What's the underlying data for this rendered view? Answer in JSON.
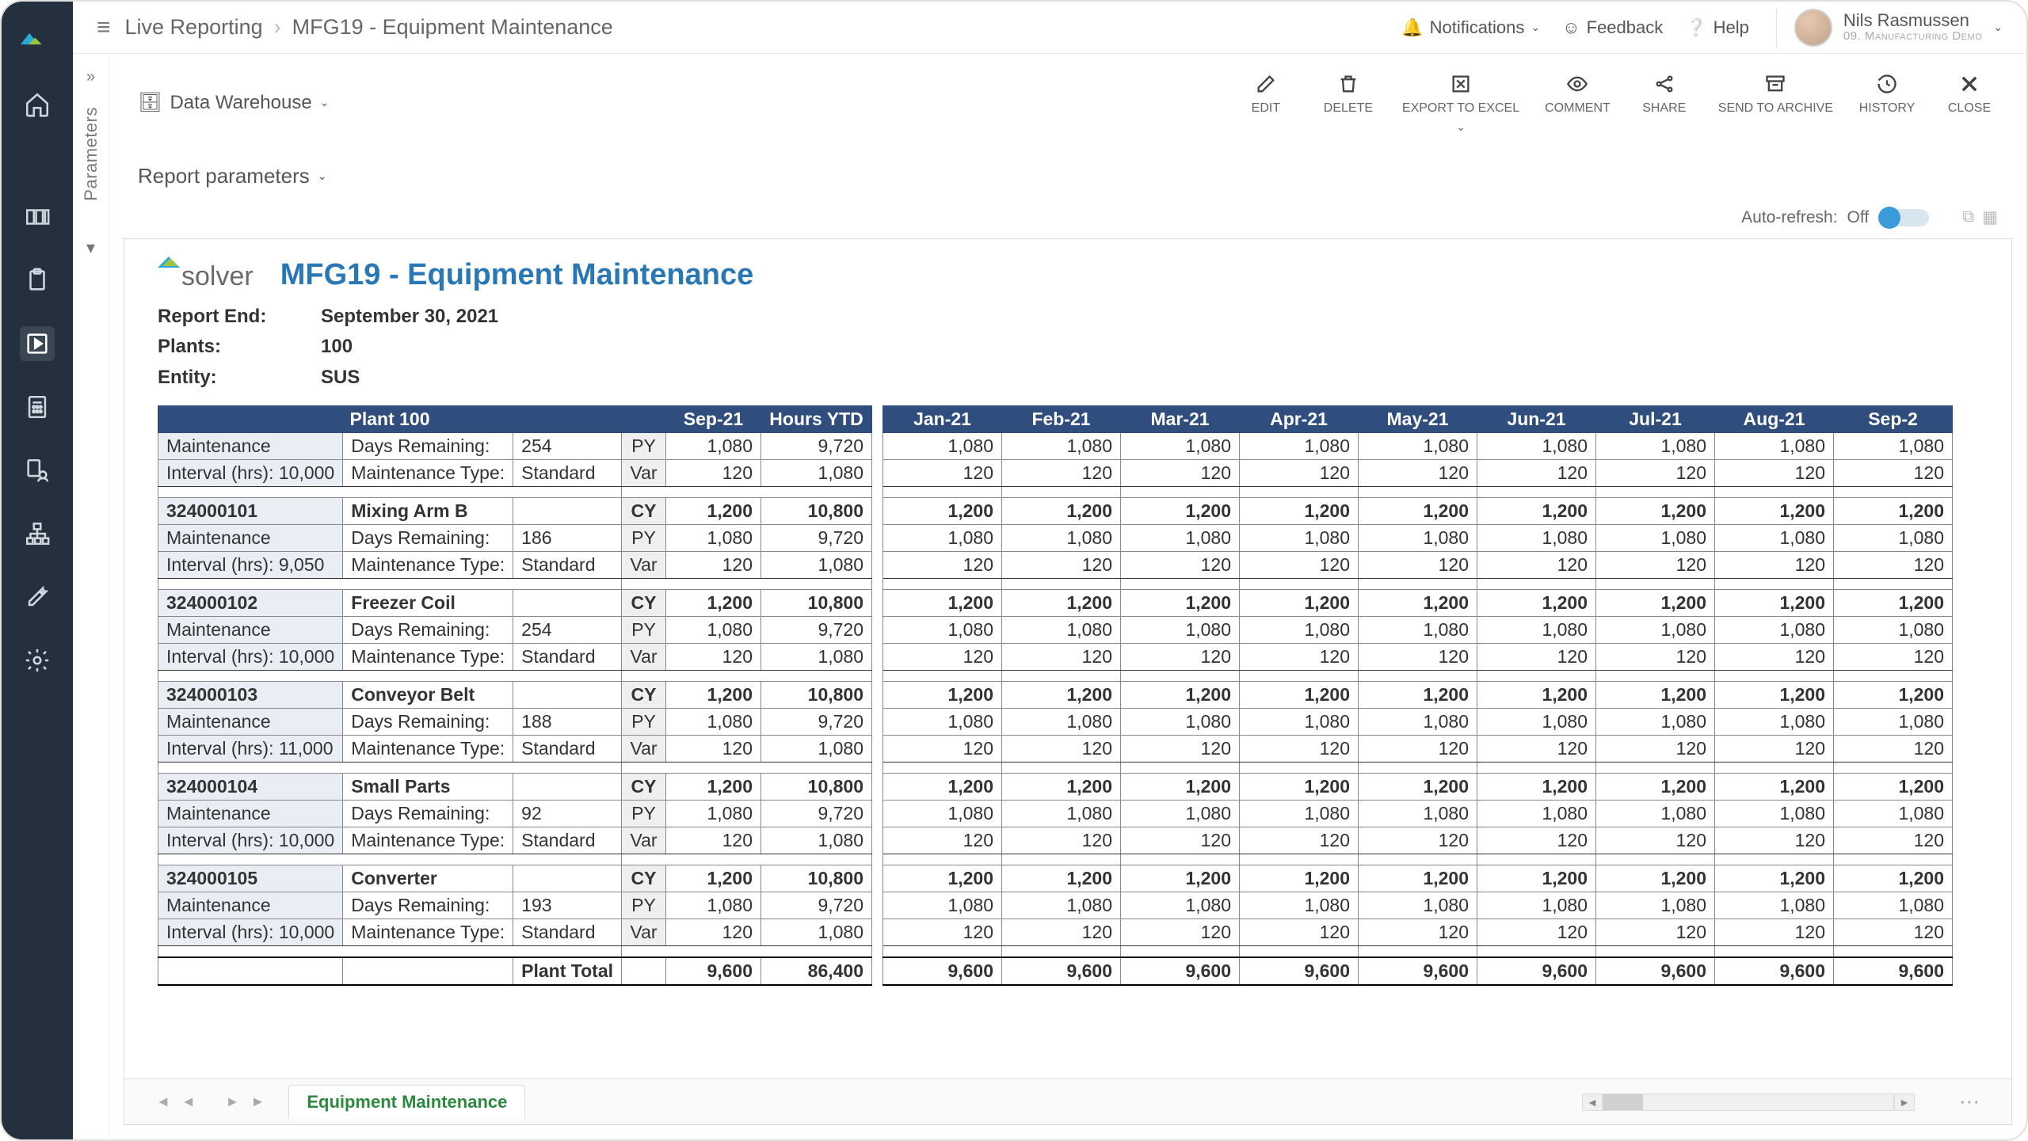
{
  "breadcrumb": {
    "section": "Live Reporting",
    "page": "MFG19 - Equipment Maintenance"
  },
  "topbar": {
    "notifications": "Notifications",
    "feedback": "Feedback",
    "help": "Help",
    "user_name": "Nils Rasmussen",
    "user_sub": "09. Manufacturing Demo"
  },
  "params_rail": {
    "label": "Parameters"
  },
  "data_source": {
    "label": "Data Warehouse"
  },
  "toolbar": {
    "edit": "EDIT",
    "delete": "DELETE",
    "export": "EXPORT TO EXCEL",
    "comment": "COMMENT",
    "share": "SHARE",
    "archive": "SEND TO ARCHIVE",
    "history": "HISTORY",
    "close": "CLOSE"
  },
  "report_params_label": "Report parameters",
  "autorefresh": {
    "label": "Auto-refresh:",
    "value": "Off"
  },
  "report": {
    "brand": "solver",
    "title": "MFG19 - Equipment Maintenance",
    "meta": {
      "report_end_label": "Report End:",
      "report_end_value": "September 30, 2021",
      "plants_label": "Plants:",
      "plants_value": "100",
      "entity_label": "Entity:",
      "entity_value": "SUS"
    },
    "headers": {
      "plant": "Plant 100",
      "sep": "Sep-21",
      "hours_ytd": "Hours YTD",
      "months": [
        "Jan-21",
        "Feb-21",
        "Mar-21",
        "Apr-21",
        "May-21",
        "Jun-21",
        "Jul-21",
        "Aug-21",
        "Sep-2"
      ]
    },
    "labels": {
      "maintenance": "Maintenance",
      "days_remaining": "Days Remaining:",
      "interval_prefix": "Interval (hrs):",
      "maint_type": "Maintenance Type:",
      "cy": "CY",
      "py": "PY",
      "var": "Var",
      "plant_total": "Plant Total"
    },
    "months_cy": [
      "1,200",
      "1,200",
      "1,200",
      "1,200",
      "1,200",
      "1,200",
      "1,200",
      "1,200",
      "1,200"
    ],
    "months_py": [
      "1,080",
      "1,080",
      "1,080",
      "1,080",
      "1,080",
      "1,080",
      "1,080",
      "1,080",
      "1,080"
    ],
    "months_var": [
      "120",
      "120",
      "120",
      "120",
      "120",
      "120",
      "120",
      "120",
      "120"
    ],
    "equipment": [
      {
        "code": "",
        "name": "",
        "days_remaining": "254",
        "interval": "10,000",
        "maint_type": "Standard",
        "partial": true
      },
      {
        "code": "324000101",
        "name": "Mixing Arm B",
        "days_remaining": "186",
        "interval": "9,050",
        "maint_type": "Standard"
      },
      {
        "code": "324000102",
        "name": "Freezer Coil",
        "days_remaining": "254",
        "interval": "10,000",
        "maint_type": "Standard"
      },
      {
        "code": "324000103",
        "name": "Conveyor Belt",
        "days_remaining": "188",
        "interval": "11,000",
        "maint_type": "Standard"
      },
      {
        "code": "324000104",
        "name": "Small Parts",
        "days_remaining": "92",
        "interval": "10,000",
        "maint_type": "Standard"
      },
      {
        "code": "324000105",
        "name": "Converter",
        "days_remaining": "193",
        "interval": "10,000",
        "maint_type": "Standard"
      }
    ],
    "cy_vals": {
      "sep": "1,200",
      "ytd": "10,800"
    },
    "py_vals": {
      "sep": "1,080",
      "ytd": "9,720"
    },
    "var_vals": {
      "sep": "120",
      "ytd": "1,080"
    },
    "totals": {
      "sep": "9,600",
      "ytd": "86,400",
      "months": [
        "9,600",
        "9,600",
        "9,600",
        "9,600",
        "9,600",
        "9,600",
        "9,600",
        "9,600",
        "9,600"
      ]
    }
  },
  "footer_tab": "Equipment Maintenance"
}
